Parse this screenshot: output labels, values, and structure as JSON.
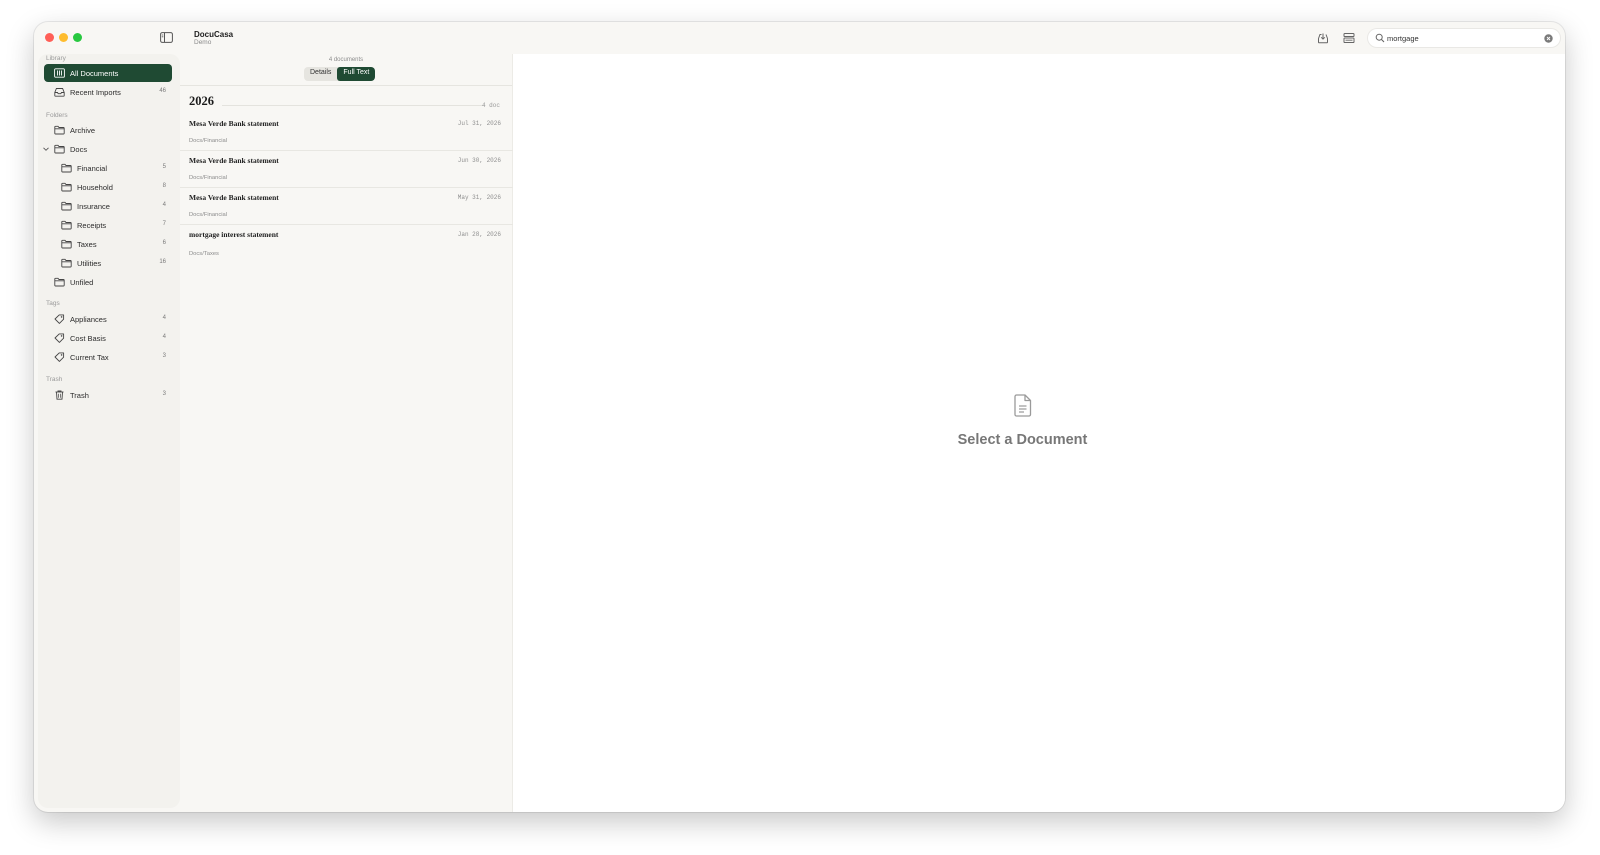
{
  "app": {
    "title": "DocuCasa",
    "subtitle": "Demo"
  },
  "toolbar": {
    "import_icon": "tray-arrow-down-icon",
    "scan_icon": "scanner-icon",
    "search": {
      "value": "mortgage",
      "placeholder": "Search"
    }
  },
  "sidebar": {
    "library_label": "Library",
    "library": [
      {
        "label": "All Documents",
        "count": "",
        "icon": "building-columns-icon",
        "active": true
      },
      {
        "label": "Recent Imports",
        "count": "46",
        "icon": "inbox-tray-icon",
        "active": false
      }
    ],
    "folders_label": "Folders",
    "folders": {
      "archive": {
        "label": "Archive",
        "count": ""
      },
      "docs": {
        "label": "Docs",
        "count": ""
      },
      "children": [
        {
          "label": "Financial",
          "count": "5"
        },
        {
          "label": "Household",
          "count": "8"
        },
        {
          "label": "Insurance",
          "count": "4"
        },
        {
          "label": "Receipts",
          "count": "7"
        },
        {
          "label": "Taxes",
          "count": "6"
        },
        {
          "label": "Utilities",
          "count": "16"
        }
      ],
      "unfiled": {
        "label": "Unfiled",
        "count": ""
      }
    },
    "tags_label": "Tags",
    "tags": [
      {
        "label": "Appliances",
        "count": "4"
      },
      {
        "label": "Cost Basis",
        "count": "4"
      },
      {
        "label": "Current Tax",
        "count": "3"
      }
    ],
    "trash_label": "Trash",
    "trash": {
      "label": "Trash",
      "count": "3"
    }
  },
  "list": {
    "doc_count": "4 documents",
    "view_modes": [
      "Details",
      "Full Text"
    ],
    "active_mode": "Full Text",
    "groups": [
      {
        "year": "2026",
        "count": "4 doc",
        "items": [
          {
            "title": "Mesa Verde Bank statement",
            "date": "Jul 31, 2026",
            "path": "Docs/Financial"
          },
          {
            "title": "Mesa Verde Bank statement",
            "date": "Jun 30, 2026",
            "path": "Docs/Financial"
          },
          {
            "title": "Mesa Verde Bank statement",
            "date": "May 31, 2026",
            "path": "Docs/Financial"
          },
          {
            "title": "mortgage interest statement",
            "date": "Jan 28, 2026",
            "path": "Docs/Taxes"
          }
        ]
      }
    ]
  },
  "detail": {
    "empty_title": "Select a Document",
    "empty_icon": "document-icon"
  },
  "colors": {
    "accent": "#1f4a33",
    "sidebar_bg": "#f3f2ee",
    "window_bg": "#f8f7f4"
  }
}
